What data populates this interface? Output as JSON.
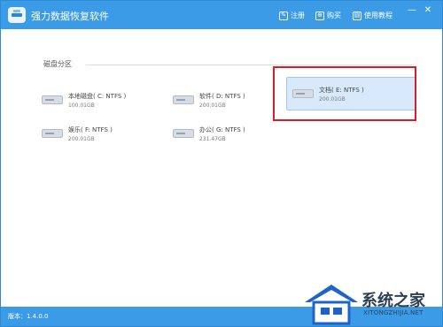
{
  "app": {
    "title": "强力数据恢复软件"
  },
  "toolbar": {
    "register_label": "注册",
    "buy_label": "购买",
    "tutorial_label": "使用教程",
    "icons": {
      "register": "register-icon",
      "buy": "cart-icon",
      "tutorial": "book-icon"
    }
  },
  "window_controls": {
    "minimize": "—",
    "close": "✕"
  },
  "section": {
    "title": "磁盘分区"
  },
  "drives": [
    {
      "name": "本地磁盘( C: NTFS )",
      "size": "100.01GB"
    },
    {
      "name": "软件( D: NTFS )",
      "size": "200.01GB"
    },
    {
      "name": "文档( E: NTFS )",
      "size": "200.01GB",
      "selected": true
    },
    {
      "name": "娱乐( F: NTFS )",
      "size": "200.01GB"
    },
    {
      "name": "办公( G: NTFS )",
      "size": "231.47GB"
    }
  ],
  "status": {
    "version": "版本：1.4.0.0"
  },
  "watermark": {
    "brand": "系统之家",
    "url": "XITONGZHIJIA.NET"
  },
  "colors": {
    "accent": "#3c9be6",
    "highlight_border": "#d61f26",
    "selected_bg": "#d7e9fa"
  }
}
